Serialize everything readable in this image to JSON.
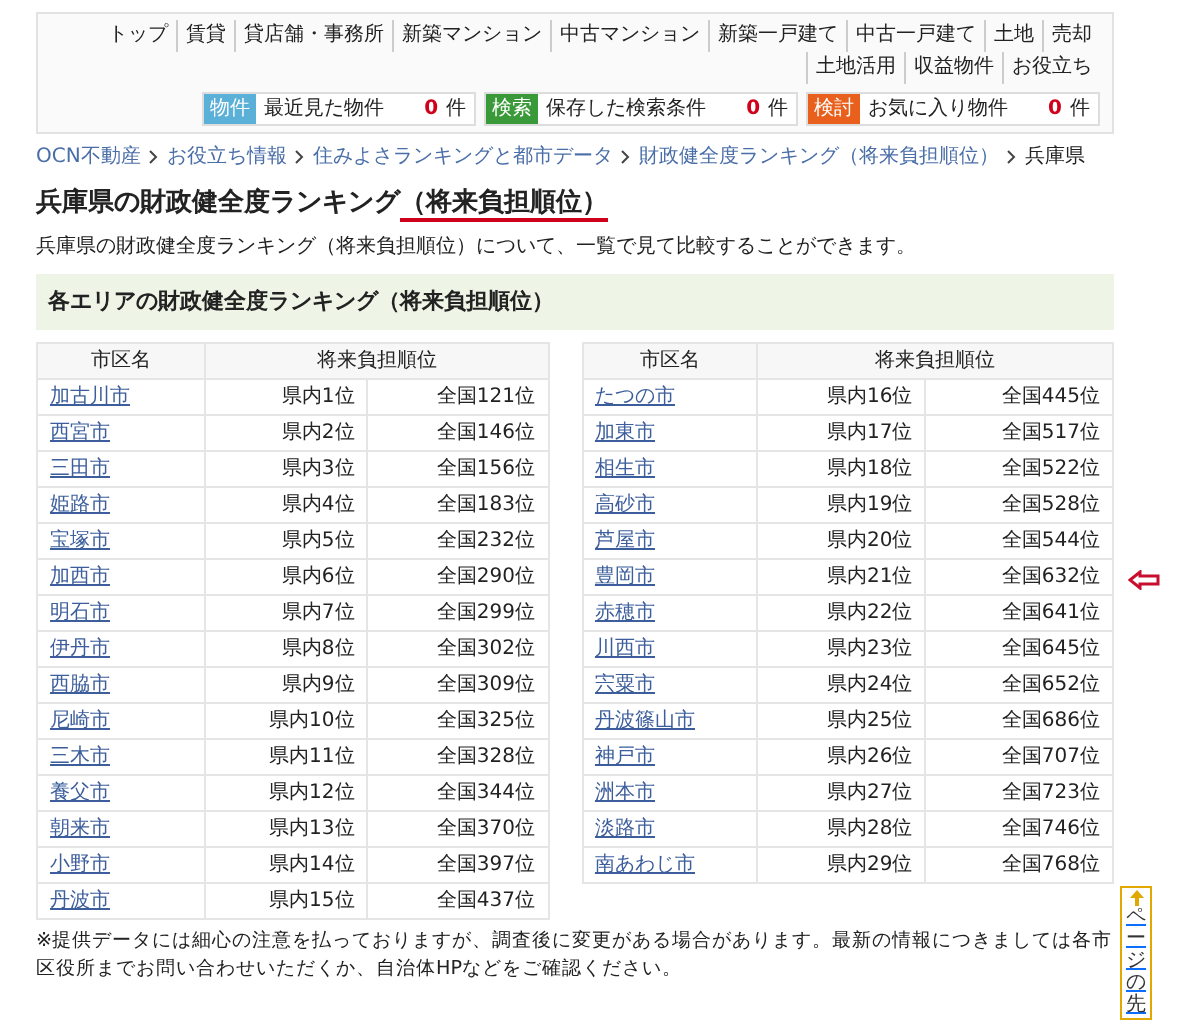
{
  "nav": {
    "items": [
      "トップ",
      "賃貸",
      "貸店舗・事務所",
      "新築マンション",
      "中古マンション",
      "新築一戸建て",
      "中古一戸建て",
      "土地",
      "売却",
      "土地活用",
      "収益物件",
      "お役立ち"
    ],
    "counters": [
      {
        "tag": "物件",
        "color": "#5bb0d8",
        "label": "最近見た物件",
        "count": "0",
        "unit": "件"
      },
      {
        "tag": "検索",
        "color": "#3a9a3a",
        "label": "保存した検索条件",
        "count": "0",
        "unit": "件"
      },
      {
        "tag": "検討",
        "color": "#e8601c",
        "label": "お気に入り物件",
        "count": "0",
        "unit": "件"
      }
    ]
  },
  "breadcrumb": {
    "links": [
      "OCN不動産",
      "お役立ち情報",
      "住みよさランキングと都市データ",
      "財政健全度ランキング（将来負担順位）"
    ],
    "current": "兵庫県"
  },
  "heading": {
    "parts": [
      {
        "text": "兵庫県の財政健全度ランキング",
        "underlined": false
      },
      {
        "text": "（将来負担順位）",
        "underlined": true
      }
    ]
  },
  "description": "兵庫県の財政健全度ランキング（将来負担順位）について、一覧で見て比較することができます。",
  "section_title": "各エリアの財政健全度ランキング（将来負担順位）",
  "tables": [
    {
      "columns": [
        {
          "label": "市区名"
        },
        {
          "label": "将来負担順位",
          "colspan": 2
        }
      ],
      "rows": [
        [
          "加古川市",
          "県内1位",
          "全国121位"
        ],
        [
          "西宮市",
          "県内2位",
          "全国146位"
        ],
        [
          "三田市",
          "県内3位",
          "全国156位"
        ],
        [
          "姫路市",
          "県内4位",
          "全国183位"
        ],
        [
          "宝塚市",
          "県内5位",
          "全国232位"
        ],
        [
          "加西市",
          "県内6位",
          "全国290位"
        ],
        [
          "明石市",
          "県内7位",
          "全国299位"
        ],
        [
          "伊丹市",
          "県内8位",
          "全国302位"
        ],
        [
          "西脇市",
          "県内9位",
          "全国309位"
        ],
        [
          "尼崎市",
          "県内10位",
          "全国325位"
        ],
        [
          "三木市",
          "県内11位",
          "全国328位"
        ],
        [
          "養父市",
          "県内12位",
          "全国344位"
        ],
        [
          "朝来市",
          "県内13位",
          "全国370位"
        ],
        [
          "小野市",
          "県内14位",
          "全国397位"
        ],
        [
          "丹波市",
          "県内15位",
          "全国437位"
        ]
      ]
    },
    {
      "columns": [
        {
          "label": "市区名"
        },
        {
          "label": "将来負担順位",
          "colspan": 2
        }
      ],
      "rows": [
        [
          "たつの市",
          "県内16位",
          "全国445位"
        ],
        [
          "加東市",
          "県内17位",
          "全国517位"
        ],
        [
          "相生市",
          "県内18位",
          "全国522位"
        ],
        [
          "高砂市",
          "県内19位",
          "全国528位"
        ],
        [
          "芦屋市",
          "県内20位",
          "全国544位"
        ],
        [
          "豊岡市",
          "県内21位",
          "全国632位"
        ],
        [
          "赤穂市",
          "県内22位",
          "全国641位"
        ],
        [
          "川西市",
          "県内23位",
          "全国645位"
        ],
        [
          "宍粟市",
          "県内24位",
          "全国652位"
        ],
        [
          "丹波篠山市",
          "県内25位",
          "全国686位"
        ],
        [
          "神戸市",
          "県内26位",
          "全国707位"
        ],
        [
          "洲本市",
          "県内27位",
          "全国723位"
        ],
        [
          "淡路市",
          "県内28位",
          "全国746位"
        ],
        [
          "南あわじ市",
          "県内29位",
          "全国768位"
        ]
      ]
    }
  ],
  "footnote": "※提供データには細心の注意を払っておりますが、調査後に変更がある場合があります。最新の情報につきましては各市区役所までお問い合わせいただくか、自治体HPなどをご確認ください。",
  "page_top_button": "ページの先"
}
